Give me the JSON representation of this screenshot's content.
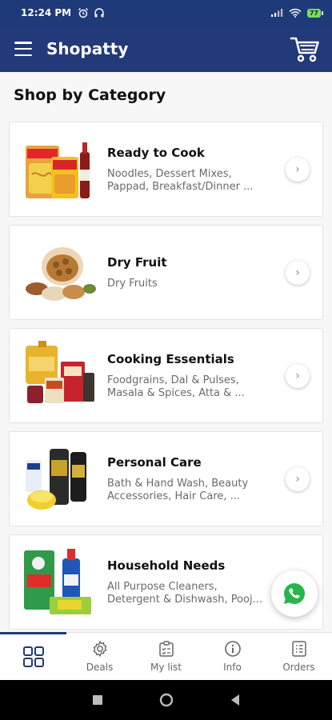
{
  "status_bar": {
    "time": "12:24 PM",
    "battery": "77"
  },
  "app_bar": {
    "title": "Shopatty"
  },
  "section_title": "Shop by Category",
  "categories": [
    {
      "title": "Ready to Cook",
      "subtitle": "Noodles, Dessert Mixes,\nPappad, Breakfast/Dinner ..."
    },
    {
      "title": "Dry Fruit",
      "subtitle": "Dry Fruits"
    },
    {
      "title": "Cooking Essentials",
      "subtitle": "Foodgrains, Dal & Pulses,\nMasala & Spices, Atta & ..."
    },
    {
      "title": "Personal Care",
      "subtitle": "Bath & Hand Wash, Beauty\nAccessories, Hair Care, ..."
    },
    {
      "title": "Household Needs",
      "subtitle": "All Purpose Cleaners,\nDetergent & Dishwash, Pooj..."
    }
  ],
  "bottom_nav": [
    {
      "label": "",
      "icon": "grid-icon",
      "active": true
    },
    {
      "label": "Deals",
      "icon": "gear-icon"
    },
    {
      "label": "My list",
      "icon": "checklist-icon"
    },
    {
      "label": "Info",
      "icon": "info-icon"
    },
    {
      "label": "Orders",
      "icon": "orders-icon"
    }
  ],
  "colors": {
    "primary": "#22397a",
    "whatsapp": "#25b74b"
  }
}
